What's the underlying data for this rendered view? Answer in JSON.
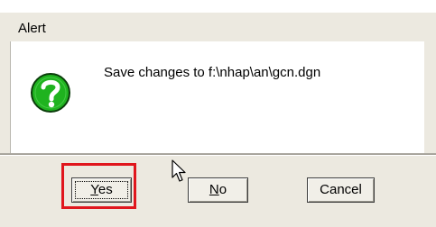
{
  "dialog": {
    "title": "Alert",
    "message": "Save changes to f:\\nhap\\an\\gcn.dgn",
    "icon": "question-icon"
  },
  "buttons": {
    "yes": {
      "prefix": "",
      "underlined": "Y",
      "suffix": "es"
    },
    "no": {
      "prefix": "",
      "underlined": "N",
      "suffix": "o"
    },
    "cancel": {
      "label": "Cancel"
    }
  },
  "colors": {
    "highlight": "#e0161d",
    "icon_green": "#1fb31f"
  }
}
